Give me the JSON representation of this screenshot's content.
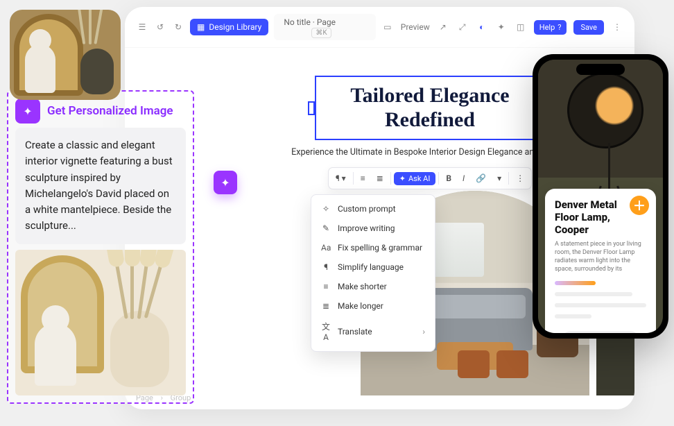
{
  "toolbar": {
    "design_library": "Design Library",
    "doc_title": "No title · Page",
    "shortcut": "⌘K",
    "preview": "Preview",
    "help": "Help",
    "save": "Save"
  },
  "page": {
    "headline_l1": "Tailored Elegance",
    "headline_l2": "Redefined",
    "subheadline": "Experience the Ultimate in Bespoke Interior Design Elegance and Luxury."
  },
  "format_bar": {
    "ask_ai": "Ask AI",
    "bold": "B",
    "italic": "I"
  },
  "ai_menu": {
    "items": [
      {
        "icon": "✧",
        "label": "Custom prompt"
      },
      {
        "icon": "✎",
        "label": "Improve writing"
      },
      {
        "icon": "Aa",
        "label": "Fix spelling & grammar"
      },
      {
        "icon": "¶",
        "label": "Simplify language"
      },
      {
        "icon": "≡",
        "label": "Make shorter"
      },
      {
        "icon": "≣",
        "label": "Make longer"
      },
      {
        "icon": "文A",
        "label": "Translate",
        "chevron": true
      }
    ]
  },
  "breadcrumb": [
    "Page",
    "Group"
  ],
  "overlay": {
    "title": "Get Personalized Image",
    "prompt": "Create a classic and elegant interior vignette featuring a bust sculpture inspired by Michelangelo's David placed on a white mantelpiece. Beside the sculpture..."
  },
  "phone": {
    "product_title": "Denver Metal Floor Lamp, Cooper",
    "product_desc": "A statement piece in your living room, the Denver Floor Lamp radiates warm light into the space, surrounded by its"
  }
}
